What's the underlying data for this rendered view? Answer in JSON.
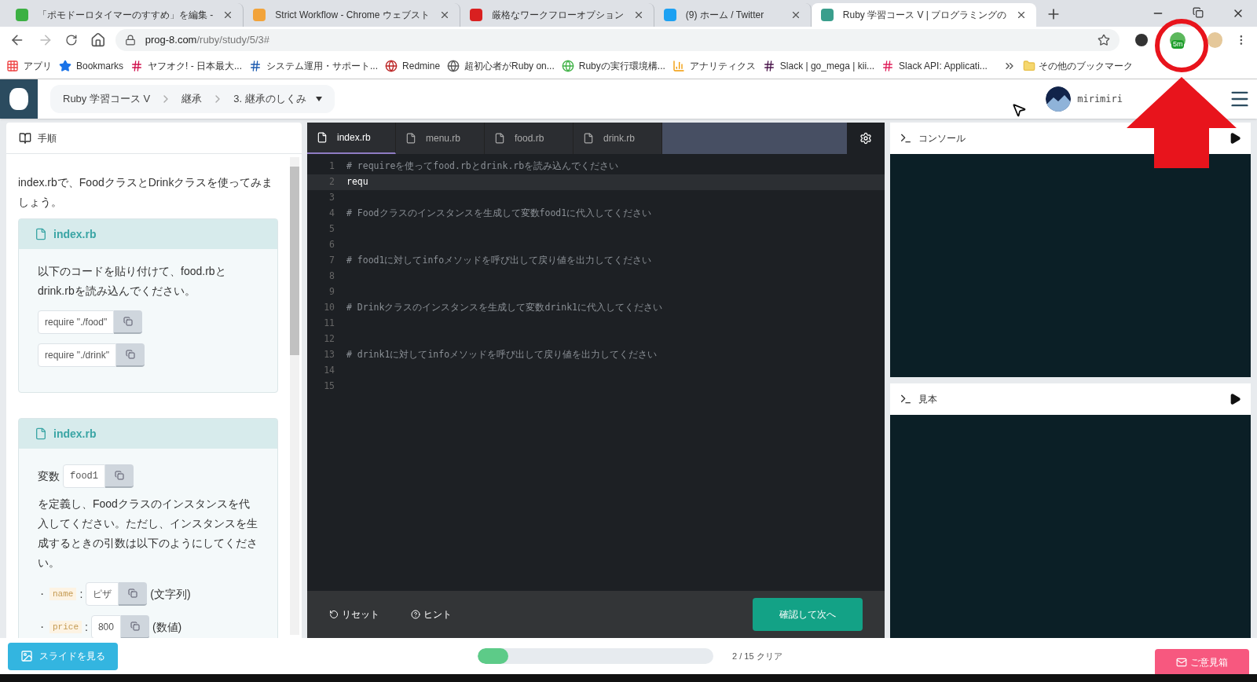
{
  "browser": {
    "tabs": [
      {
        "title": "「ポモドーロタイマーのすすめ」を編集 -",
        "selected": false
      },
      {
        "title": "Strict Workflow - Chrome ウェブスト",
        "selected": false
      },
      {
        "title": "厳格なワークフローオプション",
        "selected": false
      },
      {
        "title": "(9) ホーム / Twitter",
        "selected": false
      },
      {
        "title": "Ruby 学習コース V | プログラミングの",
        "selected": true
      }
    ],
    "address": {
      "host": "prog-8.com",
      "path": "/ruby/study/5/3#"
    },
    "extension_badge": "5m",
    "bookmarks": [
      "アプリ",
      "Bookmarks",
      "ヤフオク! - 日本最大...",
      "システム運用・サポート...",
      "Redmine",
      "超初心者がRuby on...",
      "Rubyの実行環境構...",
      "アナリティクス",
      "Slack | go_mega | kii...",
      "Slack API: Applicati..."
    ],
    "more_bookmarks": "その他のブックマーク"
  },
  "header": {
    "breadcrumb": [
      "Ruby 学習コース V",
      "継承",
      "3. 継承のしくみ"
    ],
    "user": "mirimiri"
  },
  "instructions": {
    "title": "手順",
    "intro": "index.rbで、FoodクラスとDrinkクラスを使ってみましょう。",
    "steps": [
      {
        "kind": "snippets",
        "file": "index.rb",
        "text": "以下のコードを貼り付けて、food.rbとdrink.rbを読み込んでください。",
        "snippets": [
          "require \"./food\"",
          "require \"./drink\""
        ]
      },
      {
        "kind": "params",
        "file": "index.rb",
        "before": "変数",
        "snippet": "food1",
        "after": "を定義し、Foodクラスのインスタンスを代入してください。ただし、インスタンスを生成するときの引数は以下のようにしてください。",
        "params": [
          {
            "bullet": "・",
            "key": "name",
            "separator": ":",
            "value": "ピザ",
            "note": "(文字列)"
          },
          {
            "bullet": "・",
            "key": "price",
            "separator": ":",
            "value": "800",
            "note": "(数値)"
          }
        ]
      }
    ]
  },
  "editor": {
    "files": [
      {
        "name": "index.rb",
        "selected": true
      },
      {
        "name": "menu.rb",
        "selected": false
      },
      {
        "name": "food.rb",
        "selected": false
      },
      {
        "name": "drink.rb",
        "selected": false
      }
    ],
    "lines": [
      {
        "number": "1",
        "text": "# requireを使ってfood.rbとdrink.rbを読み込んでください",
        "kind": "comment",
        "current": false
      },
      {
        "number": "2",
        "text": "requ",
        "kind": "code",
        "current": true
      },
      {
        "number": "3",
        "current": false
      },
      {
        "number": "4",
        "text": "# Foodクラスのインスタンスを生成して変数food1に代入してください",
        "kind": "comment",
        "current": false
      },
      {
        "number": "5",
        "current": false
      },
      {
        "number": "6",
        "current": false
      },
      {
        "number": "7",
        "text": "# food1に対してinfoメソッドを呼び出して戻り値を出力してください",
        "kind": "comment",
        "current": false
      },
      {
        "number": "8",
        "current": false
      },
      {
        "number": "9",
        "current": false
      },
      {
        "number": "10",
        "text": "# Drinkクラスのインスタンスを生成して変数drink1に代入してください",
        "kind": "comment",
        "current": false
      },
      {
        "number": "11",
        "current": false
      },
      {
        "number": "12",
        "current": false
      },
      {
        "number": "13",
        "text": "# drink1に対してinfoメソッドを呼び出して戻り値を出力してください",
        "kind": "comment",
        "current": false
      },
      {
        "number": "14",
        "current": false
      },
      {
        "number": "15",
        "current": false
      }
    ],
    "reset": "リセット",
    "hint": "ヒント",
    "submit": "確認して次へ"
  },
  "panels": [
    {
      "title": "コンソール"
    },
    {
      "title": "見本"
    }
  ],
  "footer": {
    "slides": "スライドを見る",
    "progress": {
      "level": 0.13,
      "label": "2 / 15 クリア"
    },
    "feedback": "ご意見箱"
  }
}
